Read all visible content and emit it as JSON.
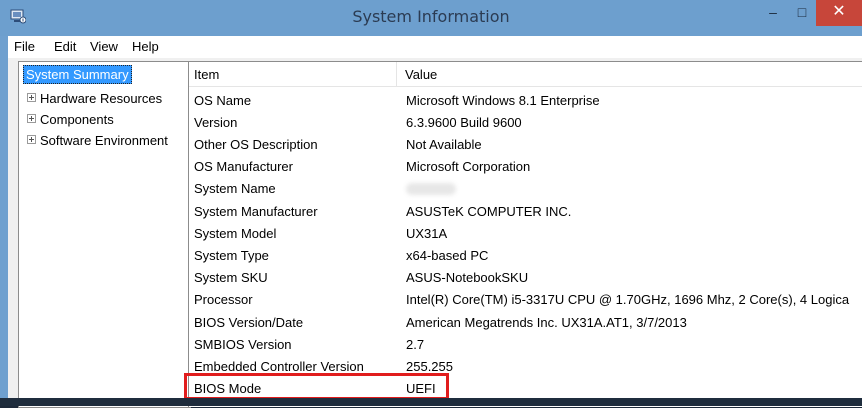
{
  "window": {
    "title": "System Information"
  },
  "titlebar_buttons": {
    "minimize": "–",
    "maximize": "□",
    "close": "✕"
  },
  "menu": [
    "File",
    "Edit",
    "View",
    "Help"
  ],
  "tree": {
    "selected": "System Summary",
    "nodes": [
      "Hardware Resources",
      "Components",
      "Software Environment"
    ]
  },
  "table": {
    "headers": {
      "item": "Item",
      "value": "Value"
    },
    "rows": [
      {
        "item": "OS Name",
        "value": "Microsoft Windows 8.1 Enterprise"
      },
      {
        "item": "Version",
        "value": "6.3.9600 Build 9600"
      },
      {
        "item": "Other OS Description",
        "value": "Not Available"
      },
      {
        "item": "OS Manufacturer",
        "value": "Microsoft Corporation"
      },
      {
        "item": "System Name",
        "value": ""
      },
      {
        "item": "System Manufacturer",
        "value": "ASUSTeK COMPUTER INC."
      },
      {
        "item": "System Model",
        "value": "UX31A"
      },
      {
        "item": "System Type",
        "value": "x64-based PC"
      },
      {
        "item": "System SKU",
        "value": "ASUS-NotebookSKU"
      },
      {
        "item": "Processor",
        "value": "Intel(R) Core(TM) i5-3317U CPU @ 1.70GHz, 1696 Mhz, 2 Core(s), 4 Logica"
      },
      {
        "item": "BIOS Version/Date",
        "value": "American Megatrends Inc. UX31A.AT1, 3/7/2013"
      },
      {
        "item": "SMBIOS Version",
        "value": "2.7"
      },
      {
        "item": "Embedded Controller Version",
        "value": "255.255"
      },
      {
        "item": "BIOS Mode",
        "value": "UEFI"
      }
    ]
  },
  "colors": {
    "highlight": "#e11d1d",
    "selection": "#3399ff",
    "titlebar": "#6d9fce",
    "close": "#c7463a"
  }
}
